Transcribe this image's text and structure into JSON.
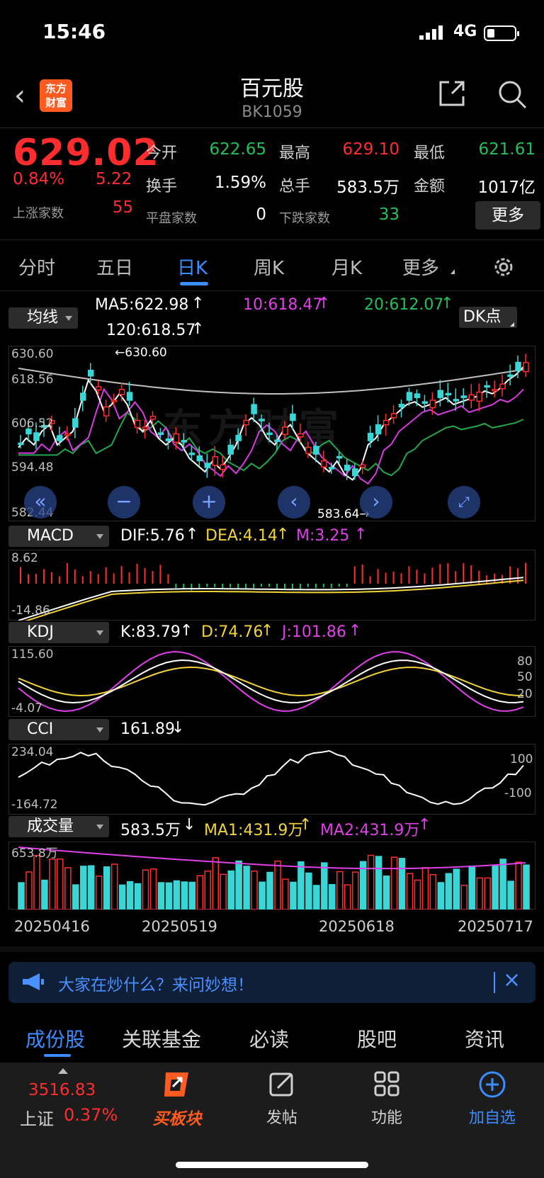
{
  "status": {
    "time": "15:46",
    "network": "4G"
  },
  "header": {
    "title": "百元股",
    "code": "BK1059",
    "logo_text": "东方财富"
  },
  "quote": {
    "price": "629.02",
    "change_pct": "0.84%",
    "change": "5.22",
    "open_label": "今开",
    "open": "622.65",
    "high_label": "最高",
    "high": "629.10",
    "low_label": "最低",
    "low": "621.61",
    "turnover_label": "换手",
    "turnover": "1.59%",
    "volume_label": "总手",
    "volume": "583.5万",
    "amount_label": "金额",
    "amount": "1017亿",
    "up_label": "上涨家数",
    "up_count": "55",
    "flat_label": "平盘家数",
    "flat_count": "0",
    "down_label": "下跌家数",
    "down_count": "33",
    "more": "更多"
  },
  "period_tabs": [
    "分时",
    "五日",
    "日K",
    "周K",
    "月K",
    "更多"
  ],
  "ma_panel": {
    "selector": "均线",
    "ma5": "MA5:622.98",
    "ma10": "10:618.47",
    "ma20": "20:612.07",
    "ma120": "120:618.57",
    "dk_button": "DK点",
    "axis_labels": [
      "630.60",
      "618.56",
      "606.52",
      "594.48",
      "582.44"
    ],
    "high_mark": "630.60",
    "low_mark": "583.64",
    "watermark": "东方财富"
  },
  "macd_panel": {
    "selector": "MACD",
    "dif": "DIF:5.76",
    "dea": "DEA:4.14",
    "m": "M:3.25",
    "axis_top": "8.62",
    "axis_bottom": "-14.86"
  },
  "kdj_panel": {
    "selector": "KDJ",
    "k": "K:83.79",
    "d": "D:74.76",
    "j": "J:101.86",
    "axis_top": "115.60",
    "axis_bottom": "-4.07",
    "levels": [
      "80",
      "50",
      "20"
    ]
  },
  "cci_panel": {
    "selector": "CCI",
    "value": "161.89",
    "axis_top": "234.04",
    "axis_bottom": "-164.72",
    "levels": [
      "100",
      "-100"
    ]
  },
  "vol_panel": {
    "selector": "成交量",
    "value": "583.5万",
    "ma1": "MA1:431.9万",
    "ma2": "MA2:431.9万",
    "axis_top": "653.8万"
  },
  "dates": [
    "20250416",
    "20250519",
    "20250618",
    "20250717"
  ],
  "ask_bar": {
    "text": "大家在炒什么？来问妙想！"
  },
  "bottom_tabs": [
    "成份股",
    "关联基金",
    "必读",
    "股吧",
    "资讯"
  ],
  "bottom_nav": {
    "index_value": "3516.83",
    "index_name": "上证",
    "index_change": "0.37%",
    "items": [
      "买板块",
      "发帖",
      "功能",
      "加自选"
    ]
  },
  "colors": {
    "up": "#ff2d2d",
    "down": "#22c05a",
    "accent": "#3b8cff",
    "cyan": "#3ad6d6"
  }
}
